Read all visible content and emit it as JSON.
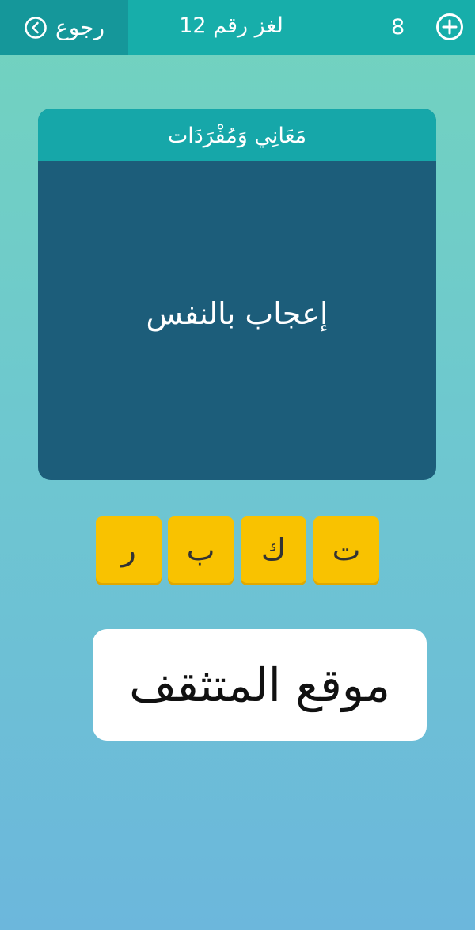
{
  "header": {
    "back_label": "رجوع",
    "back_icon": "chevron-left-circle-icon",
    "puzzle_title": "لغز رقم 12",
    "coin_count": "8",
    "add_icon": "plus-circle-icon"
  },
  "card": {
    "category": "مَعَانِي وَمُفْرَدَات",
    "clue": "إعجاب بالنفس"
  },
  "tiles": [
    "ت",
    "ك",
    "ب",
    "ر"
  ],
  "watermark": {
    "text": "موقع المتثقف"
  },
  "colors": {
    "topbar": "#17aeaa",
    "back_button": "#15979a",
    "card_header": "#16a7a9",
    "card_body": "#1c5d7a",
    "tile": "#f9c200",
    "watermark_bg": "#ffffff"
  }
}
